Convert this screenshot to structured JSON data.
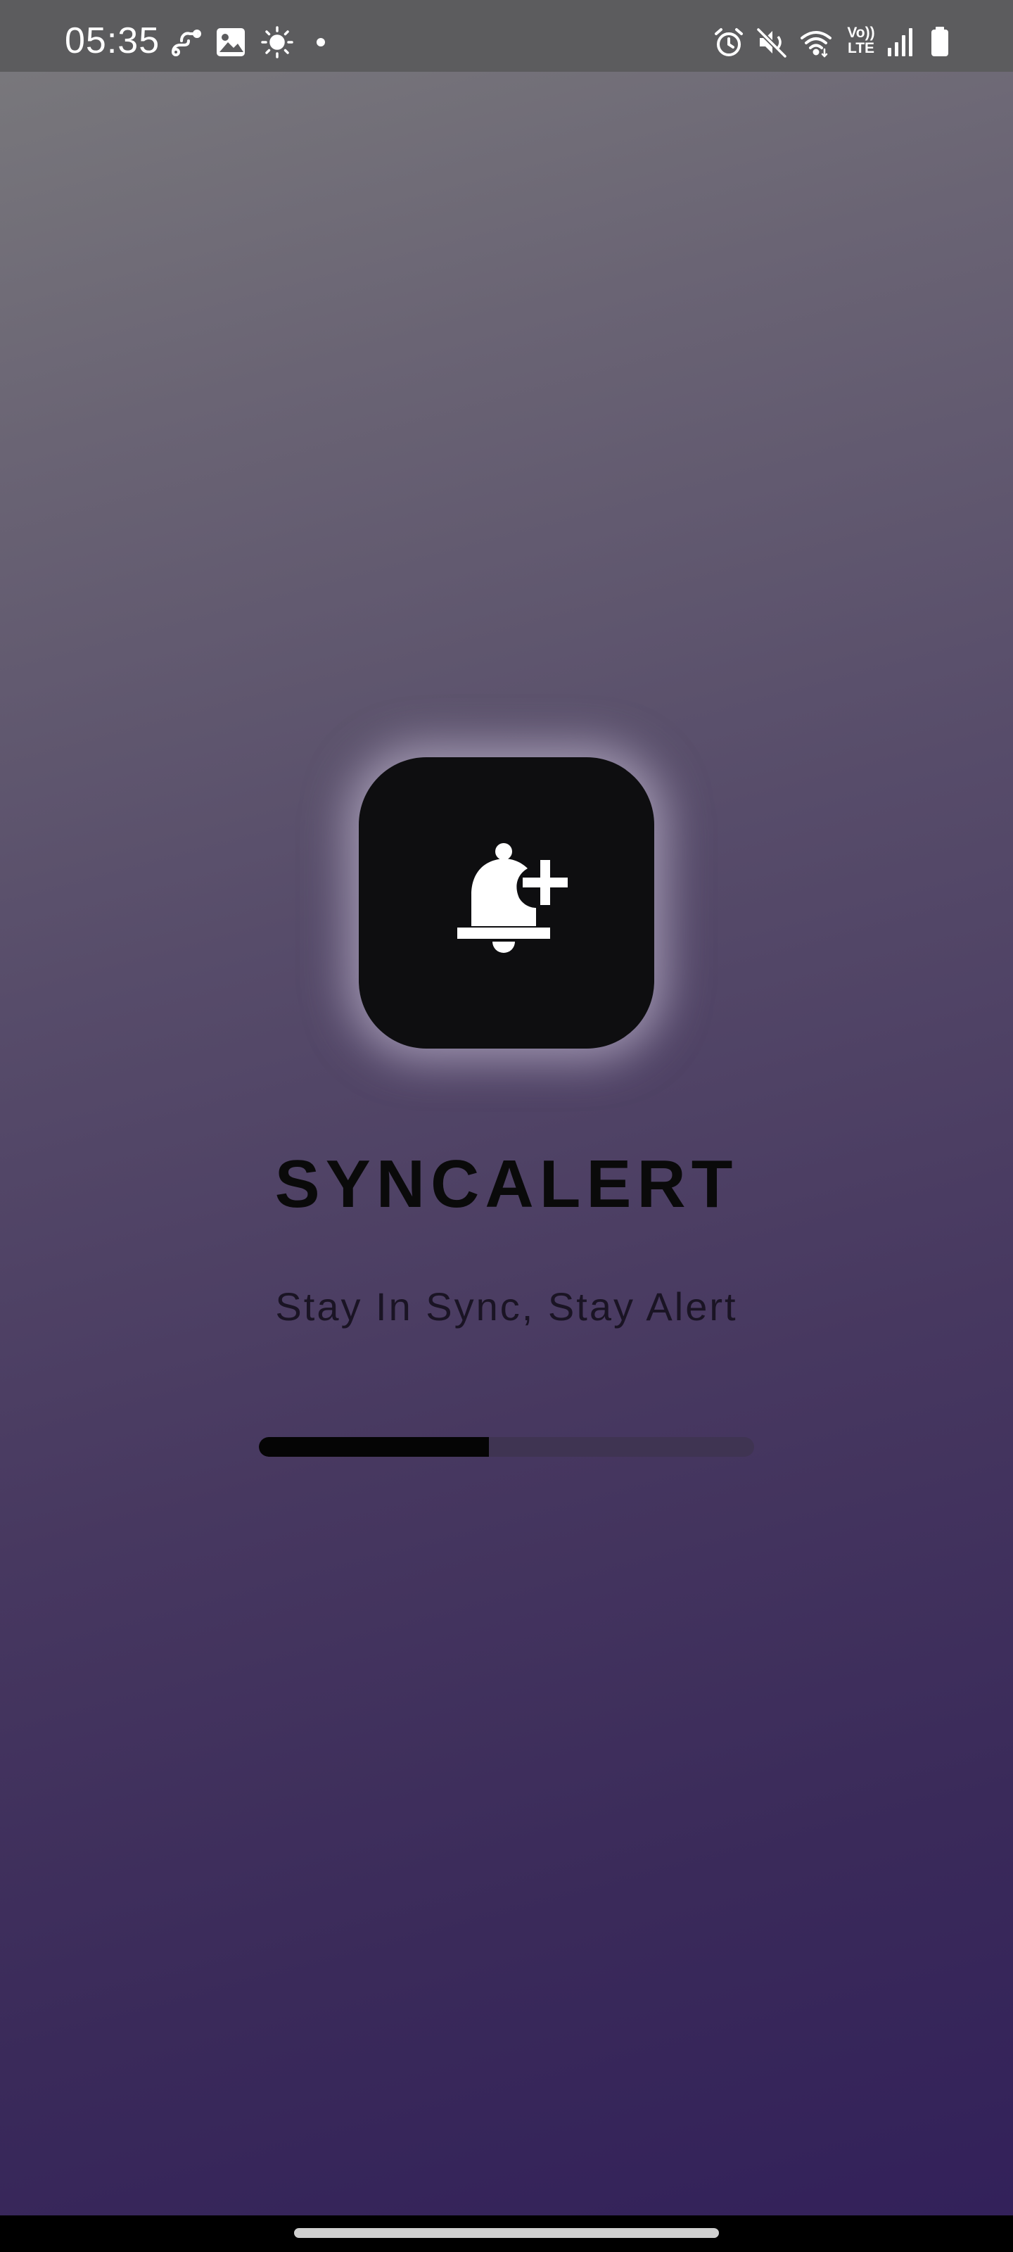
{
  "status_bar": {
    "time": "05:35",
    "left_icons": [
      "link-icon",
      "gallery-icon",
      "brightness-icon",
      "notification-dot-icon"
    ],
    "right_icons": [
      "alarm-icon",
      "mute-icon",
      "wifi-icon",
      "volte-icon",
      "signal-icon",
      "battery-icon"
    ],
    "volte_line1": "Vo))",
    "volte_line2": "LTE"
  },
  "splash": {
    "app_icon": "bell-plus-icon",
    "app_name": "SYNCALERT",
    "tagline": "Stay In Sync, Stay Alert",
    "progress_fraction": 0.465
  },
  "nav_bar": {
    "home_indicator": "home-gesture-bar"
  },
  "colors": {
    "background_top": "#7b7b7d",
    "background_bottom": "#32205a",
    "status_bar": "#5c5c5e",
    "icon_tile": "#0e0e10",
    "progress_fill": "#050505",
    "progress_track": "#3f3452"
  }
}
